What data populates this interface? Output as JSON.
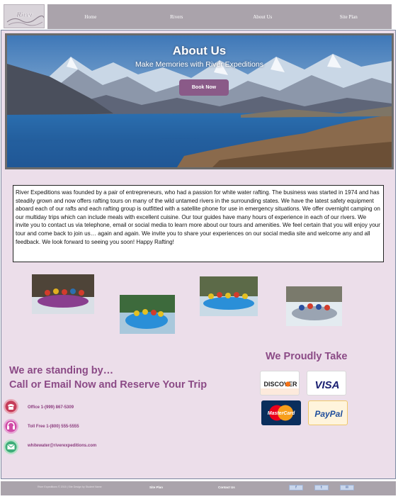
{
  "logo": {
    "text": "River"
  },
  "nav": {
    "items": [
      "Home",
      "Rivers",
      "About Us",
      "Site Plan"
    ]
  },
  "hero": {
    "title": "About Us",
    "subtitle": "Make Memories with River Expeditions",
    "button_label": "Book Now"
  },
  "about": {
    "text": "River Expeditions was founded by a pair of entrepreneurs, who had a passion for white water rafting.  The business was started in 1974 and has steadily grown and now offers rafting tours on many of the wild untamed rivers in the surrounding states.  We have the latest safety equipment aboard each of our rafts and each rafting group is outfitted with a satellite phone for use in emergency situations.  We offer overnight camping on our multiday trips which can include meals with excellent cuisine.  Our tour guides have many hours of experience in each of our rivers.  We invite you to contact us via telephone, email or social media to learn more about our tours and amenities.  We feel certain that you will enjoy your tour and come back to join us… again and again.  We invite you to share your experiences on our social media site and welcome any and all feedback.  We look forward to seeing you soon!  Happy Rafting!"
  },
  "contact": {
    "heading_line1": "We are standing by…",
    "heading_line2": "Call or Email Now and Reserve Your Trip",
    "office": "Office 1-(999) 867-5309",
    "toll_free": "Toll Free 1-(800) 555-5555",
    "email": "whitewater@riverexpeditions.com"
  },
  "payment": {
    "heading": "We Proudly Take",
    "cards": [
      "DISCOVER",
      "VISA",
      "MasterCard",
      "PayPal"
    ]
  },
  "footer": {
    "copyright": "River Expeditions © 2015 | Site Design by Student Name",
    "site_plan": "Site Plan",
    "contact_us": "Contact Us"
  },
  "icons": [
    "phone-icon",
    "headset-icon",
    "mail-icon",
    "facebook-icon",
    "twitter-icon",
    "email-icon"
  ],
  "colors": {
    "accent": "#8b4a86",
    "nav": "#aaa3ab",
    "background": "#ecdeea",
    "button": "#8a5a88"
  }
}
